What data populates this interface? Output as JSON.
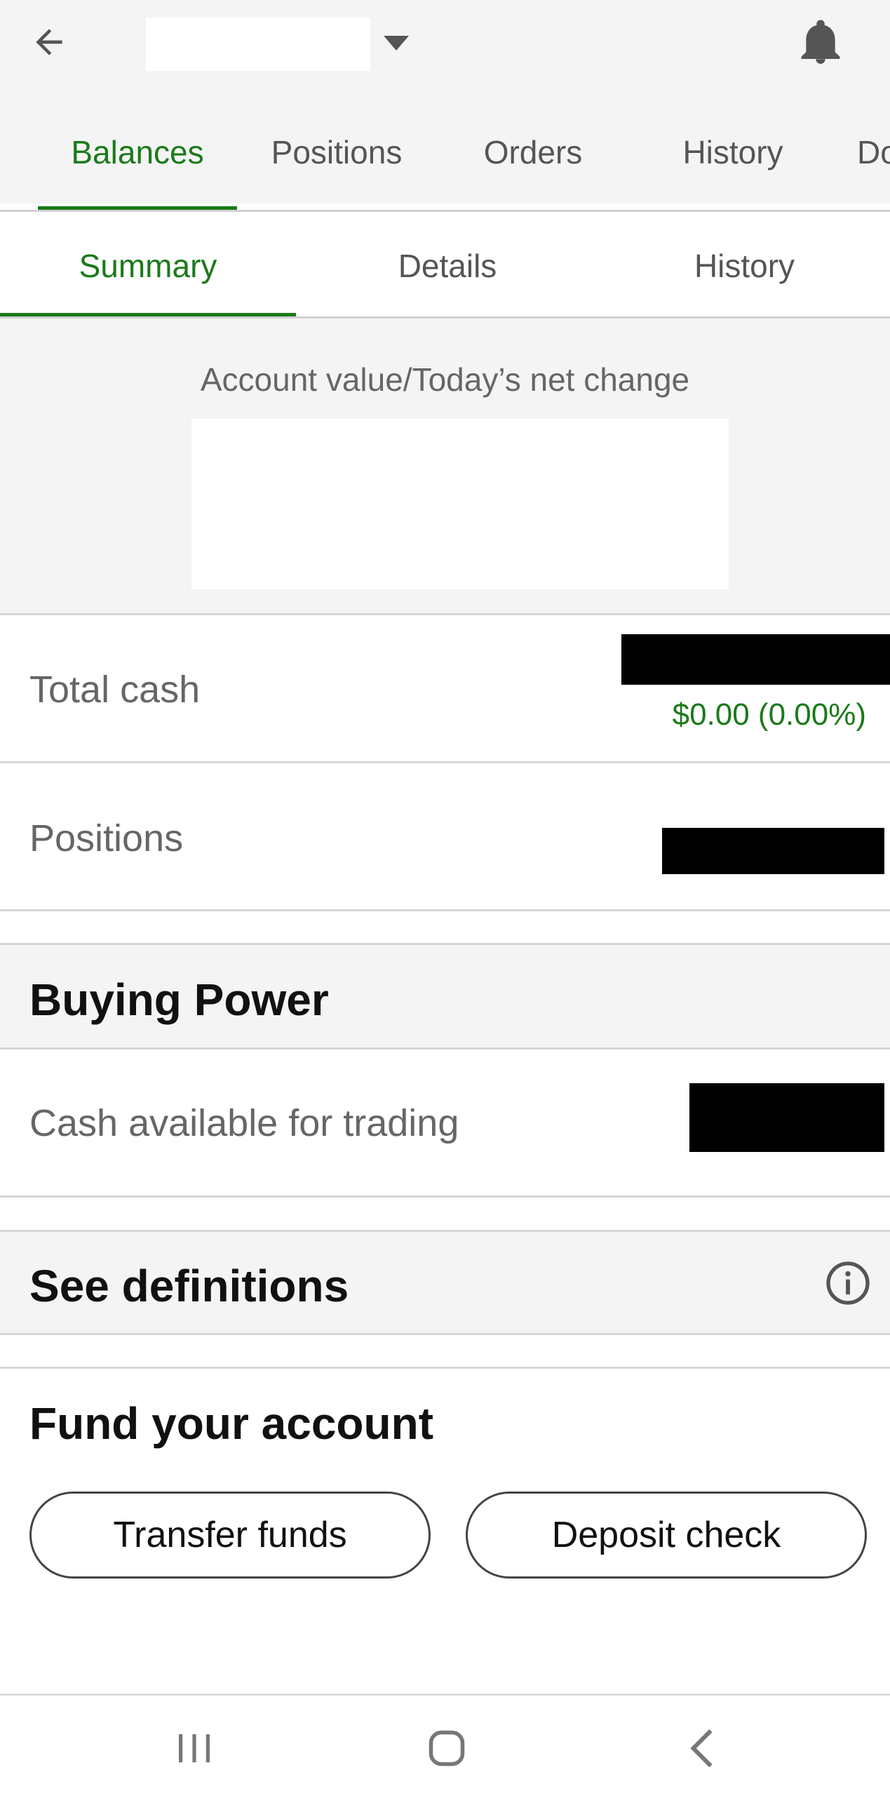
{
  "header": {
    "back_icon": "arrow-left-icon",
    "dropdown_icon": "caret-down-icon",
    "bell_icon": "bell-icon"
  },
  "main_tabs": [
    {
      "label": "Balances",
      "active": true
    },
    {
      "label": "Positions",
      "active": false
    },
    {
      "label": "Orders",
      "active": false
    },
    {
      "label": "History",
      "active": false
    },
    {
      "label": "Do",
      "active": false
    }
  ],
  "sub_tabs": [
    {
      "label": "Summary",
      "active": true
    },
    {
      "label": "Details",
      "active": false
    },
    {
      "label": "History",
      "active": false
    }
  ],
  "account_value": {
    "label": "Account value/Today’s net change"
  },
  "rows": {
    "total_cash": {
      "label": "Total cash",
      "change": "$0.00 (0.00%)"
    },
    "positions": {
      "label": "Positions"
    }
  },
  "buying_power": {
    "title": "Buying Power",
    "cash_available": {
      "label": "Cash available for trading"
    }
  },
  "definitions": {
    "title": "See definitions",
    "icon": "info-circle-icon"
  },
  "fund": {
    "title": "Fund your account",
    "transfer_label": "Transfer funds",
    "deposit_label": "Deposit check"
  },
  "nav": {
    "recents_icon": "recents-icon",
    "home_icon": "home-icon",
    "back_icon": "chevron-left-icon"
  },
  "colors": {
    "accent": "#1a7a1a",
    "background_gray": "#f4f4f4"
  }
}
